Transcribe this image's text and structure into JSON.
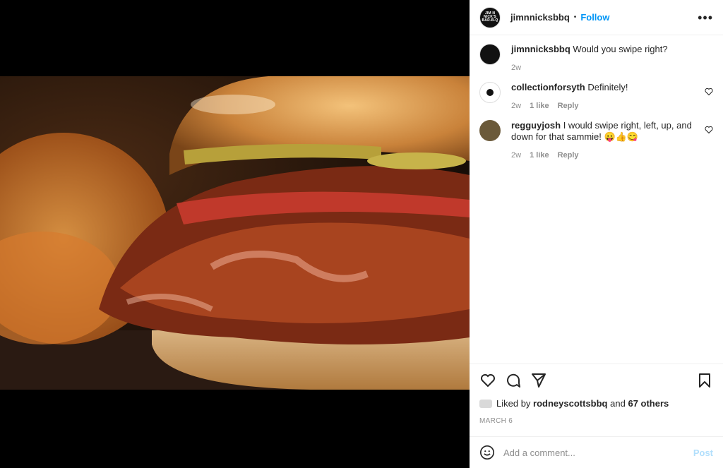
{
  "post": {
    "username": "jimnnicksbbq",
    "avatar_text": "JIM N NICK'S BAR-B-Q",
    "follow_label": "Follow",
    "separator": "•",
    "more_label": "•••"
  },
  "caption": {
    "username": "jimnnicksbbq",
    "text": "Would you swipe right?",
    "time": "2w"
  },
  "comments": [
    {
      "username": "collectionforsyth",
      "text": "Definitely!",
      "time": "2w",
      "likes": "1 like",
      "reply": "Reply"
    },
    {
      "username": "regguyjosh",
      "text": "I would swipe right, left, up, and down for that sammie! 😛👍😋",
      "time": "2w",
      "likes": "1 like",
      "reply": "Reply"
    }
  ],
  "likes": {
    "prefix": "Liked by",
    "user": "rodneyscottsbbq",
    "and": "and",
    "others": "67 others"
  },
  "date": "MARCH 6",
  "add_comment": {
    "placeholder": "Add a comment...",
    "emoji_icon": "emoji-icon",
    "post_label": "Post"
  },
  "icons": [
    "heart-icon",
    "comment-icon",
    "share-icon",
    "bookmark-icon",
    "more-icon"
  ],
  "colors": {
    "link": "#0095f6",
    "post_disabled": "#b2dffc",
    "muted": "#8e8e8e",
    "text": "#262626"
  }
}
